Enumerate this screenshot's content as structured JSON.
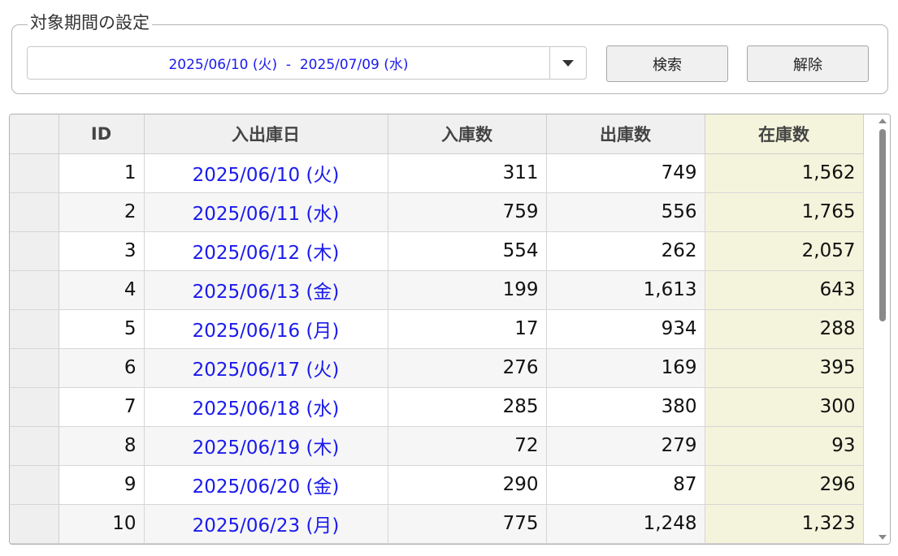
{
  "filter": {
    "legend": "対象期間の設定",
    "range_text": "2025/06/10 (火)  -  2025/07/09 (水)",
    "search_label": "検索",
    "clear_label": "解除"
  },
  "table": {
    "columns": [
      "ID",
      "入出庫日",
      "入庫数",
      "出庫数",
      "在庫数"
    ],
    "rows": [
      {
        "id": "1",
        "date": "2025/06/10 (火)",
        "in": "311",
        "out": "749",
        "stock": "1,562"
      },
      {
        "id": "2",
        "date": "2025/06/11 (水)",
        "in": "759",
        "out": "556",
        "stock": "1,765"
      },
      {
        "id": "3",
        "date": "2025/06/12 (木)",
        "in": "554",
        "out": "262",
        "stock": "2,057"
      },
      {
        "id": "4",
        "date": "2025/06/13 (金)",
        "in": "199",
        "out": "1,613",
        "stock": "643"
      },
      {
        "id": "5",
        "date": "2025/06/16 (月)",
        "in": "17",
        "out": "934",
        "stock": "288"
      },
      {
        "id": "6",
        "date": "2025/06/17 (火)",
        "in": "276",
        "out": "169",
        "stock": "395"
      },
      {
        "id": "7",
        "date": "2025/06/18 (水)",
        "in": "285",
        "out": "380",
        "stock": "300"
      },
      {
        "id": "8",
        "date": "2025/06/19 (木)",
        "in": "72",
        "out": "279",
        "stock": "93"
      },
      {
        "id": "9",
        "date": "2025/06/20 (金)",
        "in": "290",
        "out": "87",
        "stock": "296"
      },
      {
        "id": "10",
        "date": "2025/06/23 (月)",
        "in": "775",
        "out": "1,248",
        "stock": "1,323"
      }
    ]
  },
  "colors": {
    "date_text": "#1a1aee",
    "stock_column_bg": "#f4f4dc",
    "header_bg": "#f0f0f0"
  }
}
